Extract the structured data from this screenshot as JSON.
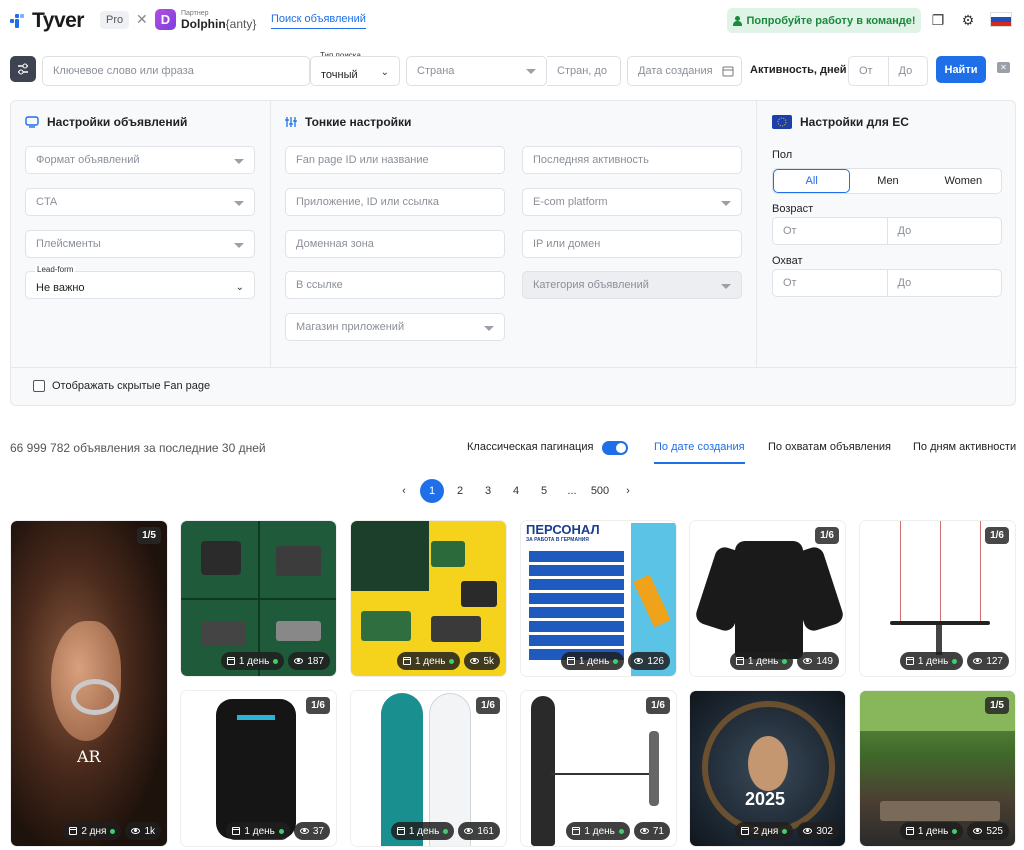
{
  "header": {
    "logo": "Tyver",
    "plan": "Pro",
    "partner_small": "Партнер",
    "partner_name": "Dolphin",
    "partner_suffix": "{anty}",
    "nav_link": "Поиск объявлений",
    "team_cta": "Попробуйте работу в команде!"
  },
  "filterbar": {
    "keyword_placeholder": "Ключевое слово или фраза",
    "search_type_label": "Тип поиска",
    "search_type_value": "точный",
    "country_placeholder": "Страна",
    "country_to_placeholder": "Стран, до",
    "date_placeholder": "Дата создания",
    "activity_label": "Активность, дней",
    "from": "От",
    "to": "До",
    "find": "Найти"
  },
  "panel": {
    "ads_settings_title": "Настройки объявлений",
    "ad_format": "Формат объявлений",
    "cta": "CTA",
    "placements": "Плейсменты",
    "lead_form_label": "Lead-form",
    "lead_form_value": "Не важно",
    "fine_title": "Тонкие настройки",
    "fanpage": "Fan page ID или название",
    "app": "Приложение, ID или ссылка",
    "domain_zone": "Доменная зона",
    "in_link": "В ссылке",
    "app_store": "Магазин приложений",
    "last_activity": "Последняя активность",
    "ecom": "E-com platform",
    "ip_domain": "IP или домен",
    "ad_category": "Категория объявлений",
    "eu_title": "Настройки для ЕС",
    "gender_label": "Пол",
    "gender_options": [
      "All",
      "Men",
      "Women"
    ],
    "age_label": "Возраст",
    "reach_label": "Охват",
    "from": "От",
    "to": "До",
    "hidden_fanpage": "Отображать скрытые Fan page"
  },
  "results": {
    "count_text": "66 999 782 объявления за последние 30 дней",
    "classic_pagination": "Классическая пагинация",
    "sort_by_date": "По дате создания",
    "sort_by_reach": "По охватам объявления",
    "sort_by_activity": "По дням активности",
    "pages": [
      "‹",
      "1",
      "2",
      "3",
      "4",
      "5",
      "...",
      "500",
      "›"
    ]
  },
  "cards": [
    {
      "badge": "1/5",
      "days": "2 дня",
      "views": "1k",
      "watermark": "AR"
    },
    {
      "badge": "",
      "days": "1 день",
      "views": "187"
    },
    {
      "badge": "",
      "days": "1 день",
      "views": "5k"
    },
    {
      "badge": "",
      "days": "1 день",
      "views": "126",
      "headline": "ПЕРСОНАЛ",
      "sub": "ЗА РАБОТА В ГЕРМАНИЯ"
    },
    {
      "badge": "1/6",
      "days": "1 день",
      "views": "149"
    },
    {
      "badge": "1/6",
      "days": "1 день",
      "views": "127"
    },
    {
      "badge": "1/6",
      "days": "1 день",
      "views": "37"
    },
    {
      "badge": "1/6",
      "days": "1 день",
      "views": "161"
    },
    {
      "badge": "1/6",
      "days": "1 день",
      "views": "71"
    },
    {
      "badge": "",
      "days": "2 дня",
      "views": "302",
      "year": "2025"
    },
    {
      "badge": "1/5",
      "days": "1 день",
      "views": "525"
    }
  ]
}
